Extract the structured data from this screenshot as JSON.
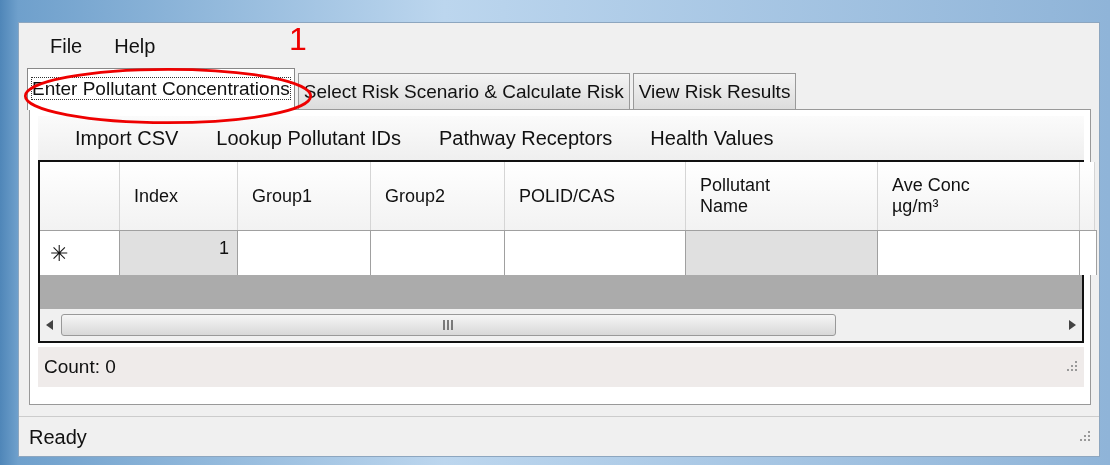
{
  "menu": [
    {
      "label": "File"
    },
    {
      "label": "Help"
    }
  ],
  "annotation": {
    "label": "1"
  },
  "tabs": [
    {
      "label": "Enter Pollutant Concentrations",
      "selected": true
    },
    {
      "label": "Select Risk Scenario & Calculate Risk",
      "selected": false
    },
    {
      "label": "View Risk Results",
      "selected": false
    }
  ],
  "toolbar": [
    {
      "label": "Import CSV"
    },
    {
      "label": "Lookup Pollutant IDs"
    },
    {
      "label": "Pathway Receptors"
    },
    {
      "label": "Health Values"
    }
  ],
  "table": {
    "columns": [
      {
        "lines": [
          "Index"
        ]
      },
      {
        "lines": [
          "Group1"
        ]
      },
      {
        "lines": [
          "Group2"
        ]
      },
      {
        "lines": [
          "POLID/CAS"
        ]
      },
      {
        "lines": [
          "Pollutant",
          "Name"
        ]
      },
      {
        "lines": [
          "Ave Conc",
          "µg/m³"
        ]
      }
    ],
    "new_row": {
      "marker": "✳",
      "cells": [
        {
          "text": "1",
          "readonly": true
        },
        {
          "text": "",
          "readonly": false
        },
        {
          "text": "",
          "readonly": false
        },
        {
          "text": "",
          "readonly": false
        },
        {
          "text": "",
          "readonly": true
        },
        {
          "text": "",
          "readonly": false
        }
      ]
    }
  },
  "count": "Count: 0",
  "status_bar": "Ready"
}
